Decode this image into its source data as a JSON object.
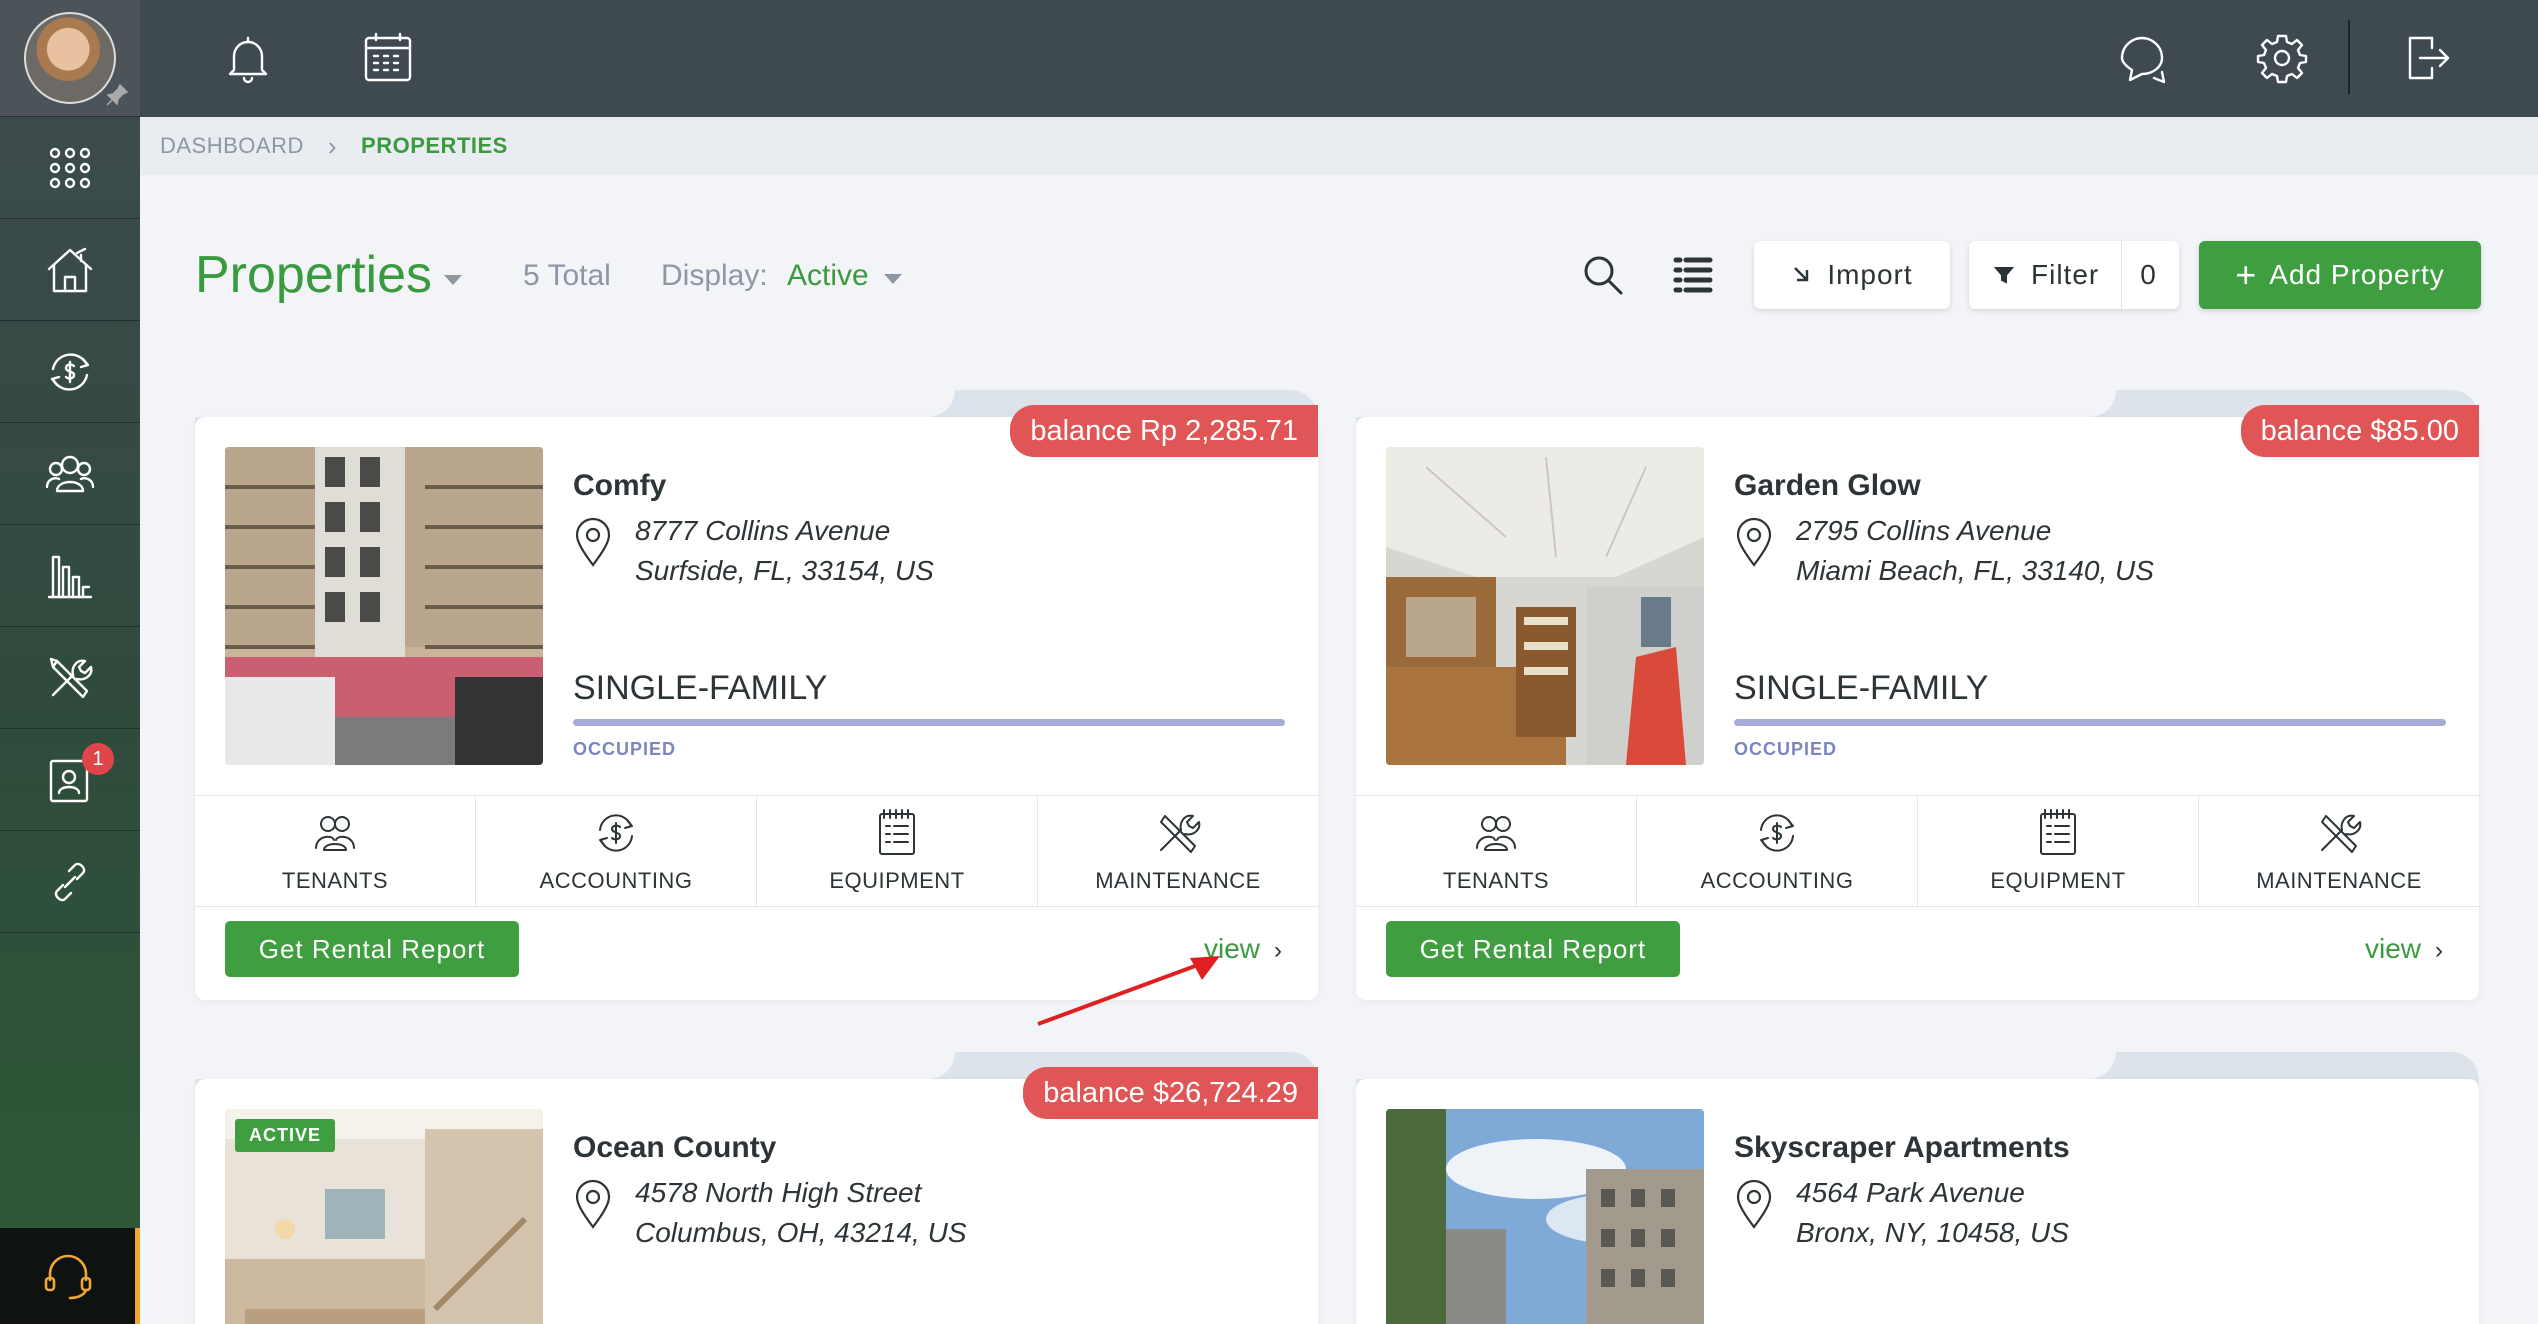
{
  "sidebar": {
    "items": [
      "apps-icon",
      "house-icon",
      "accounting-icon",
      "people-icon",
      "reports-icon",
      "maintenance-icon",
      "contacts-icon",
      "link-icon"
    ],
    "contacts_badge": "1",
    "support_icon": "headset-icon"
  },
  "topbar": {
    "left_icons": [
      "bell-icon",
      "calendar-icon"
    ],
    "right_icons": [
      "chat-icon",
      "gear-icon",
      "logout-icon"
    ]
  },
  "breadcrumb": {
    "home": "DASHBOARD",
    "current": "PROPERTIES"
  },
  "header": {
    "title": "Properties",
    "total": "5 Total",
    "display_label": "Display:",
    "display_value": "Active",
    "import_label": "Import",
    "filter_label": "Filter",
    "filter_count": "0",
    "add_label": "Add Property"
  },
  "properties": [
    {
      "name": "Comfy",
      "address_line1": "8777 Collins Avenue",
      "address_line2": "Surfside, FL, 33154, US",
      "type": "SINGLE-FAMILY",
      "status": "OCCUPIED",
      "balance": "balance Rp 2,285.71",
      "report_label": "Get Rental Report",
      "view_label": "view"
    },
    {
      "name": "Garden Glow",
      "address_line1": "2795 Collins Avenue",
      "address_line2": "Miami Beach, FL, 33140, US",
      "type": "SINGLE-FAMILY",
      "status": "OCCUPIED",
      "balance": "balance $85.00",
      "report_label": "Get Rental Report",
      "view_label": "view"
    },
    {
      "name": "Ocean County",
      "address_line1": "4578 North High Street",
      "address_line2": "Columbus, OH, 43214, US",
      "balance": "balance $26,724.29",
      "badge": "ACTIVE"
    },
    {
      "name": "Skyscraper Apartments",
      "address_line1": "4564 Park Avenue",
      "address_line2": "Bronx, NY, 10458, US"
    }
  ],
  "card_tabs": {
    "tenants": "TENANTS",
    "accounting": "ACCOUNTING",
    "equipment": "EQUIPMENT",
    "maintenance": "MAINTENANCE"
  },
  "colors": {
    "brand_green": "#3f9e3f",
    "balance_red": "#e05555",
    "topbar": "#3e4a50",
    "occupied_bar": "#a6acd8"
  }
}
